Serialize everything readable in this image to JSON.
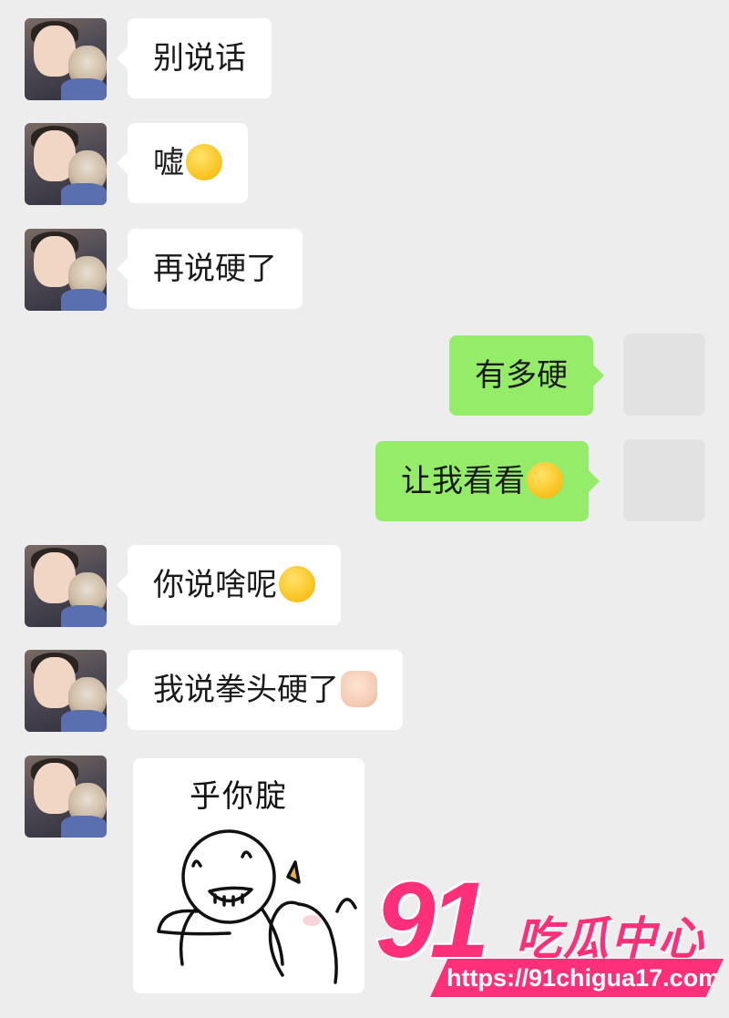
{
  "messages": [
    {
      "side": "left",
      "text": "别说话"
    },
    {
      "side": "left",
      "text": "嘘",
      "emoji": "shushing-face"
    },
    {
      "side": "left",
      "text": "再说硬了"
    },
    {
      "side": "right",
      "text": "有多硬"
    },
    {
      "side": "right",
      "text": "让我看看",
      "emoji": "grimacing-face"
    },
    {
      "side": "left",
      "text": "你说啥呢",
      "emoji": "smiling-face"
    },
    {
      "side": "left",
      "text": "我说拳头硬了",
      "emoji": "fist"
    }
  ],
  "sticker": {
    "text": "乎你腚",
    "icon": "cartoon-sticker"
  },
  "watermark": {
    "number": "91",
    "brand": "吃瓜中心",
    "url": "https://91chigua17.com"
  },
  "colors": {
    "background": "#ededed",
    "incoming_bubble": "#ffffff",
    "outgoing_bubble": "#95ec69",
    "watermark": "#ff2f7a"
  }
}
